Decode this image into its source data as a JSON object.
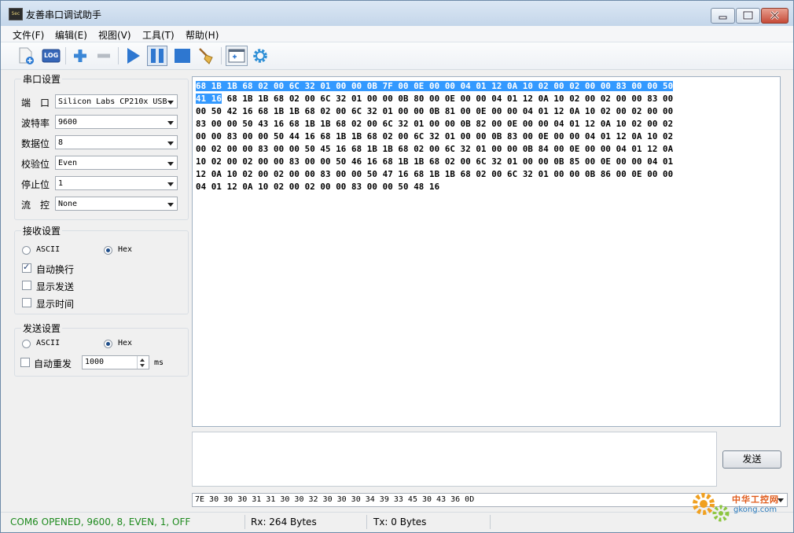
{
  "window": {
    "title": "友善串口调试助手",
    "icon_text": "Sec"
  },
  "menu": [
    {
      "label": "文件(F)"
    },
    {
      "label": "编辑(E)"
    },
    {
      "label": "视图(V)"
    },
    {
      "label": "工具(T)"
    },
    {
      "label": "帮助(H)"
    }
  ],
  "toolbar": {
    "log_label": "LOG",
    "icons": [
      "new-file-icon",
      "log-icon",
      "add-icon",
      "remove-icon",
      "play-icon",
      "pause-icon",
      "stop-icon",
      "broom-icon",
      "window-icon",
      "gear-icon"
    ]
  },
  "serial": {
    "title": "串口设置",
    "port_label": "端　口",
    "port_value": "Silicon Labs CP210x USB",
    "baud_label": "波特率",
    "baud_value": "9600",
    "data_label": "数据位",
    "data_value": "8",
    "parity_label": "校验位",
    "parity_value": "Even",
    "stop_label": "停止位",
    "stop_value": "1",
    "flow_label": "流　控",
    "flow_value": "None"
  },
  "receive": {
    "title": "接收设置",
    "ascii_label": "ASCII",
    "hex_label": "Hex",
    "hex_selected": true,
    "auto_wrap_label": "自动换行",
    "auto_wrap": true,
    "show_send_label": "显示发送",
    "show_send": false,
    "show_time_label": "显示时间",
    "show_time": false
  },
  "send": {
    "title": "发送设置",
    "ascii_label": "ASCII",
    "hex_label": "Hex",
    "hex_selected": true,
    "auto_resend_label": "自动重发",
    "auto_resend": false,
    "interval_value": "1000",
    "interval_unit": "ms",
    "button_label": "发送",
    "history_value": "7E 30 30 30 31 31 30 30 32 30 30 30 34 39 33 45 30 43 36 0D"
  },
  "receive_data": {
    "selected_line1": "68 1B 1B 68 02 00 6C 32 01 00 00 0B 7F 00 0E 00 00 04 01 12 0A 10 02 00 02 00 00 83 00 00 50",
    "line2_selected": "41 16",
    "line2_rest": " 68 1B 1B 68 02 00 6C 32 01 00 00 0B 80 00 0E 00 00 04 01 12 0A 10 02 00 02 00 00 83 00",
    "lines": [
      "00 50 42 16 68 1B 1B 68 02 00 6C 32 01 00 00 0B 81 00 0E 00 00 04 01 12 0A 10 02 00 02 00 00",
      "83 00 00 50 43 16 68 1B 1B 68 02 00 6C 32 01 00 00 0B 82 00 0E 00 00 04 01 12 0A 10 02 00 02",
      "00 00 83 00 00 50 44 16 68 1B 1B 68 02 00 6C 32 01 00 00 0B 83 00 0E 00 00 04 01 12 0A 10 02",
      "00 02 00 00 83 00 00 50 45 16 68 1B 1B 68 02 00 6C 32 01 00 00 0B 84 00 0E 00 00 04 01 12 0A",
      "10 02 00 02 00 00 83 00 00 50 46 16 68 1B 1B 68 02 00 6C 32 01 00 00 0B 85 00 0E 00 00 04 01",
      "12 0A 10 02 00 02 00 00 83 00 00 50 47 16 68 1B 1B 68 02 00 6C 32 01 00 00 0B 86 00 0E 00 00",
      "04 01 12 0A 10 02 00 02 00 00 83 00 00 50 48 16"
    ]
  },
  "status": {
    "port_status": "COM6 OPENED, 9600, 8, EVEN, 1, OFF",
    "rx": "Rx: 264 Bytes",
    "tx": "Tx: 0 Bytes",
    "port_status_color": "#1e8a1e"
  },
  "watermark": {
    "text1": "中华工控网",
    "text2": "gkong.com"
  }
}
